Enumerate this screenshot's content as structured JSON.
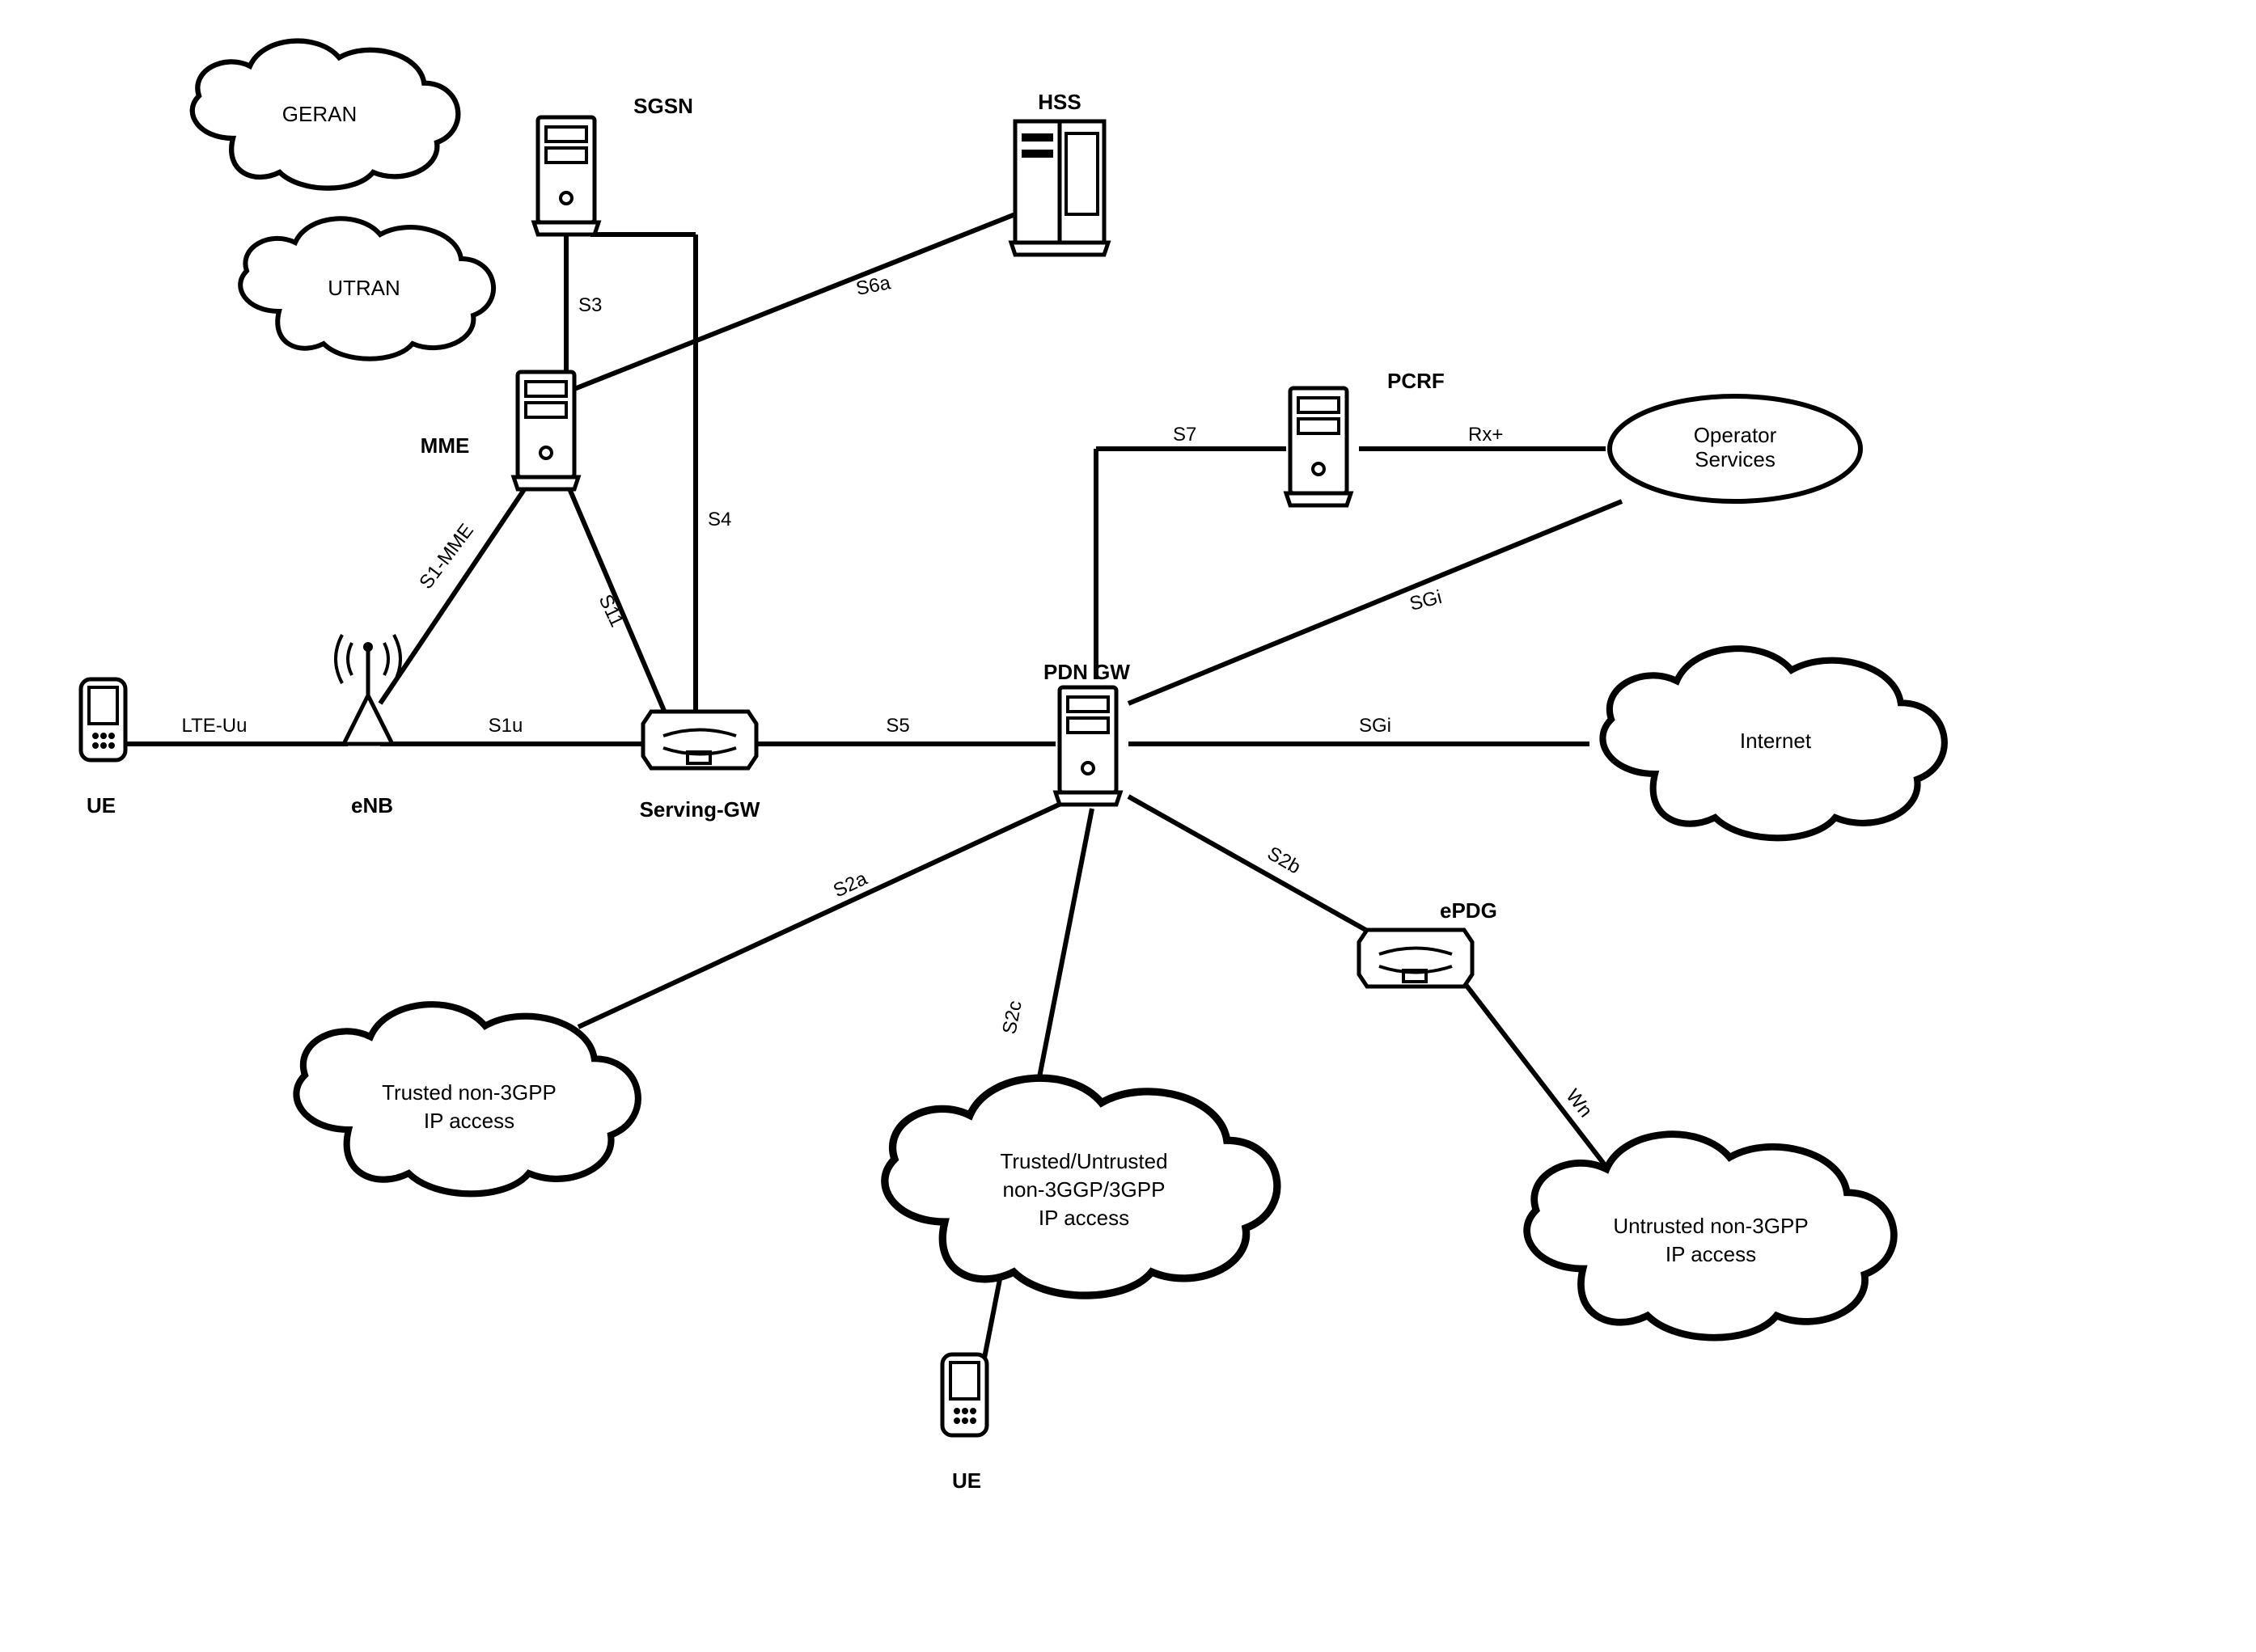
{
  "nodes": {
    "geran": {
      "label": "GERAN"
    },
    "utran": {
      "label": "UTRAN"
    },
    "sgsn": {
      "label": "SGSN"
    },
    "hss": {
      "label": "HSS"
    },
    "mme": {
      "label": "MME"
    },
    "ue1": {
      "label": "UE"
    },
    "enb": {
      "label": "eNB"
    },
    "sgw": {
      "label": "Serving-GW"
    },
    "pdngw": {
      "label": "PDN GW"
    },
    "pcrf": {
      "label": "PCRF"
    },
    "opserv": {
      "label": "Operator\nServices"
    },
    "internet": {
      "label": "Internet"
    },
    "trusted": {
      "label": "Trusted non-3GPP\nIP access"
    },
    "mixed": {
      "label": "Trusted/Untrusted\nnon-3GGP/3GPP\nIP access"
    },
    "untrusted": {
      "label": "Untrusted non-3GPP\nIP access"
    },
    "epdg": {
      "label": "ePDG"
    },
    "ue2": {
      "label": "UE"
    }
  },
  "links": {
    "lteuu": "LTE-Uu",
    "s1u": "S1u",
    "s1mme": "S1-MME",
    "s11": "S11",
    "s3": "S3",
    "s4": "S4",
    "s5": "S5",
    "s6a": "S6a",
    "s7": "S7",
    "rxplus": "Rx+",
    "sgi1": "SGi",
    "sgi2": "SGi",
    "s2a": "S2a",
    "s2b": "S2b",
    "s2c": "S2c",
    "wn": "Wn"
  }
}
